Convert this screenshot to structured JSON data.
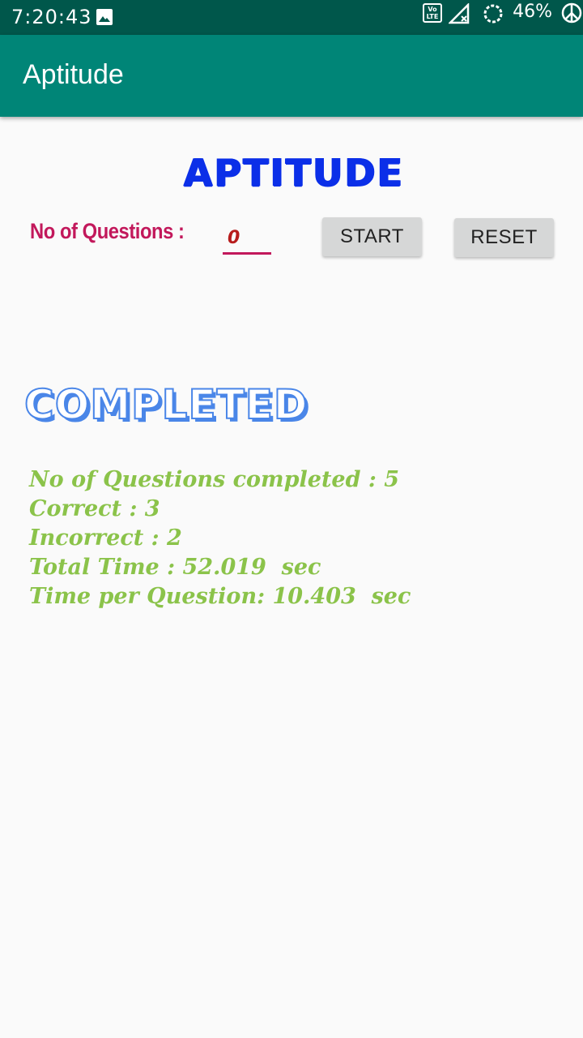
{
  "status_bar": {
    "time": "7:20:43",
    "battery": "46%",
    "icons": [
      "image-icon",
      "volte-icon",
      "signal-icon",
      "battery-icon",
      "peace-icon"
    ]
  },
  "app_bar": {
    "title": "Aptitude"
  },
  "main": {
    "heading": "APTITUDE",
    "questions_label": "No of Questions :",
    "questions_placeholder": "0",
    "start_label": "START",
    "reset_label": "RESET",
    "completed_label": "COMPLETED",
    "results": {
      "completed": "No of Questions completed : 5",
      "correct": "Correct : 3",
      "incorrect": "Incorrect : 2",
      "total_time": "Total Time : 52.019  sec",
      "time_per_question": "Time per Question: 10.403  sec"
    }
  },
  "colors": {
    "status_bar": "#00574b",
    "app_bar": "#008577",
    "heading": "#0b2fe8",
    "label": "#c2185b",
    "completed": "#4a86e8",
    "results": "#8bc34a"
  }
}
